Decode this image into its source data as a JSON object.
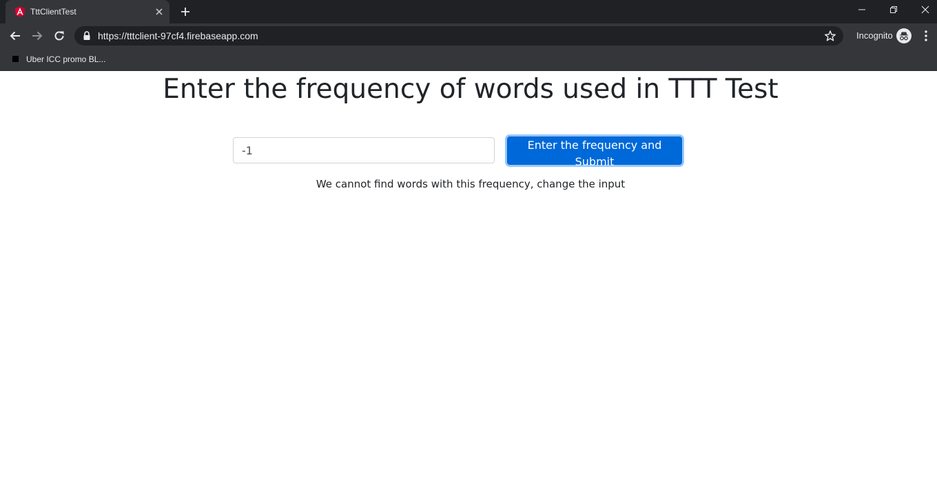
{
  "browser": {
    "tab": {
      "title": "TttClientTest",
      "favicon": "angular-icon",
      "brand_color": "#dd0031"
    },
    "omnibox": {
      "url": "https://tttclient-97cf4.firebaseapp.com"
    },
    "profile": {
      "label": "Incognito"
    },
    "bookmarks": [
      {
        "label": "Uber ICC promo BL..."
      }
    ]
  },
  "page": {
    "title": "Enter the frequency of words used in TTT Test",
    "input": {
      "value": "-1"
    },
    "submit_label": "Enter the frequency and Submit",
    "message": "We cannot find words with this frequency, change the input",
    "accent_color": "#0069d9"
  }
}
